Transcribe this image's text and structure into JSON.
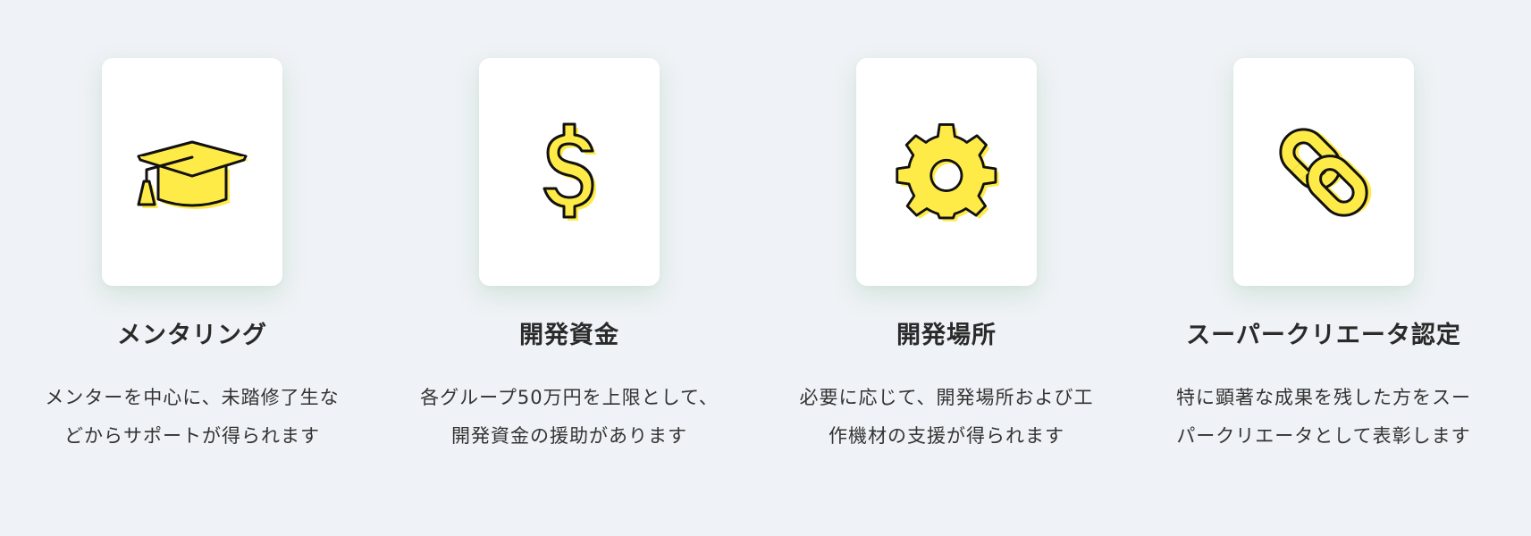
{
  "colors": {
    "background": "#eff2f6",
    "card": "#ffffff",
    "icon_fill": "#ffeb47",
    "icon_stroke": "#111111",
    "text": "#2a2a2a"
  },
  "features": [
    {
      "icon": "graduation-cap-icon",
      "title": "メンタリング",
      "desc_lines": [
        "メンターを中心に、未踏修了生な",
        "どからサポートが得られます"
      ]
    },
    {
      "icon": "dollar-icon",
      "title": "開発資金",
      "desc_lines": [
        "各グループ50万円を上限として、",
        "開発資金の援助があります"
      ]
    },
    {
      "icon": "gear-icon",
      "title": "開発場所",
      "desc_lines": [
        "必要に応じて、開発場所および工",
        "作機材の支援が得られます"
      ]
    },
    {
      "icon": "link-icon",
      "title": "スーパークリエータ認定",
      "desc_lines": [
        "特に顕著な成果を残した方をスー",
        "パークリエータとして表彰します"
      ]
    }
  ]
}
